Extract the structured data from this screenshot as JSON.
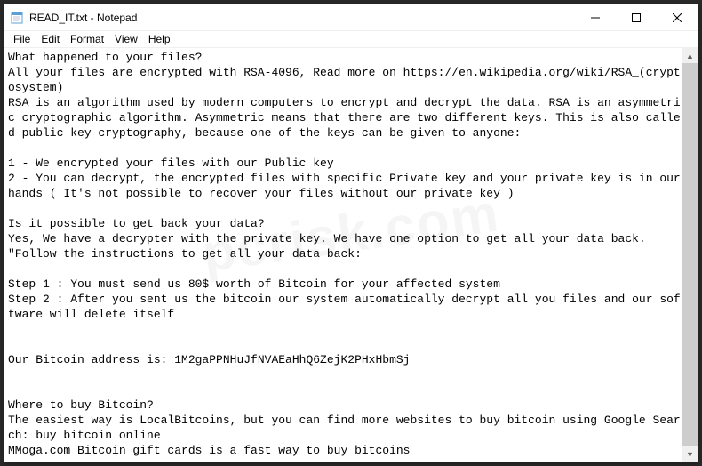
{
  "window": {
    "title": "READ_IT.txt - Notepad"
  },
  "menu": {
    "file": "File",
    "edit": "Edit",
    "format": "Format",
    "view": "View",
    "help": "Help"
  },
  "body": "What happened to your files?\nAll your files are encrypted with RSA-4096, Read more on https://en.wikipedia.org/wiki/RSA_(cryptosystem)\nRSA is an algorithm used by modern computers to encrypt and decrypt the data. RSA is an asymmetric cryptographic algorithm. Asymmetric means that there are two different keys. This is also called public key cryptography, because one of the keys can be given to anyone:\n\n1 - We encrypted your files with our Public key\n2 - You can decrypt, the encrypted files with specific Private key and your private key is in our hands ( It's not possible to recover your files without our private key )\n\nIs it possible to get back your data?\nYes, We have a decrypter with the private key. We have one option to get all your data back.\n\"Follow the instructions to get all your data back:\n\nStep 1 : You must send us 80$ worth of Bitcoin for your affected system\nStep 2 : After you sent us the bitcoin our system automatically decrypt all you files and our software will delete itself\n\n\nOur Bitcoin address is: 1M2gaPPNHuJfNVAEaHhQ6ZejK2PHxHbmSj\n\n\nWhere to buy Bitcoin?\nThe easiest way is LocalBitcoins, but you can find more websites to buy bitcoin using Google Search: buy bitcoin online\nMMoga.com Bitcoin gift cards is a fast way to buy bitcoins",
  "watermark": "pcrisk.com"
}
